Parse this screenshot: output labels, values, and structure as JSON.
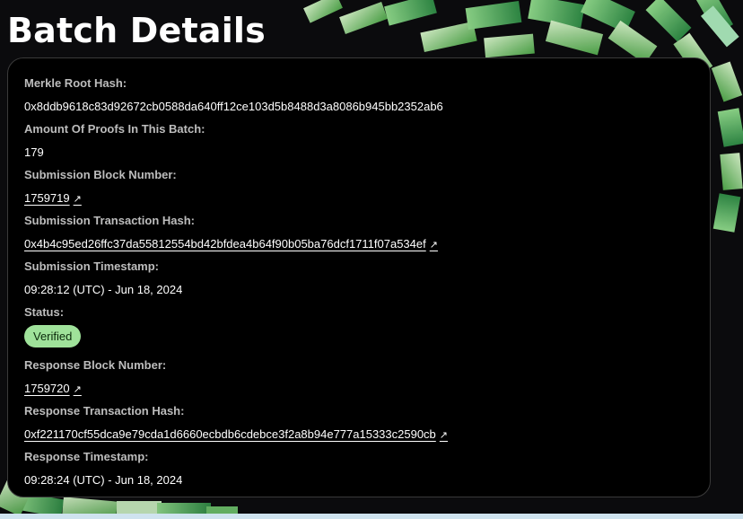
{
  "page": {
    "title": "Batch Details"
  },
  "details": {
    "merkle_root": {
      "label": "Merkle Root Hash:",
      "value": "0x8ddb9618c83d92672cb0588da640ff12ce103d5b8488d3a8086b945bb2352ab6"
    },
    "proof_count": {
      "label": "Amount Of Proofs In This Batch:",
      "value": "179"
    },
    "submission_block": {
      "label": "Submission Block Number:",
      "value": "1759719",
      "icon": "external-link-icon"
    },
    "submission_tx": {
      "label": "Submission Transaction Hash:",
      "value": "0x4b4c95ed26ffc37da55812554bd42bfdea4b64f90b05ba76dcf1711f07a534ef",
      "icon": "external-link-icon"
    },
    "submission_timestamp": {
      "label": "Submission Timestamp:",
      "value": "09:28:12 (UTC) - Jun 18, 2024"
    },
    "status": {
      "label": "Status:",
      "value": "Verified",
      "color": "#9fe29a"
    },
    "response_block": {
      "label": "Response Block Number:",
      "value": "1759720",
      "icon": "external-link-icon"
    },
    "response_tx": {
      "label": "Response Transaction Hash:",
      "value": "0xf221170cf55dca9e79cda1d6660ecbdb6cdebce3f2a8b94e777a15333c2590cb",
      "icon": "external-link-icon"
    },
    "response_timestamp": {
      "label": "Response Timestamp:",
      "value": "09:28:24 (UTC) - Jun 18, 2024"
    }
  },
  "colors": {
    "background": "#0b0b0d",
    "card": "#000000",
    "label": "#bdbdbd",
    "accent_green": "#9fe29a"
  }
}
